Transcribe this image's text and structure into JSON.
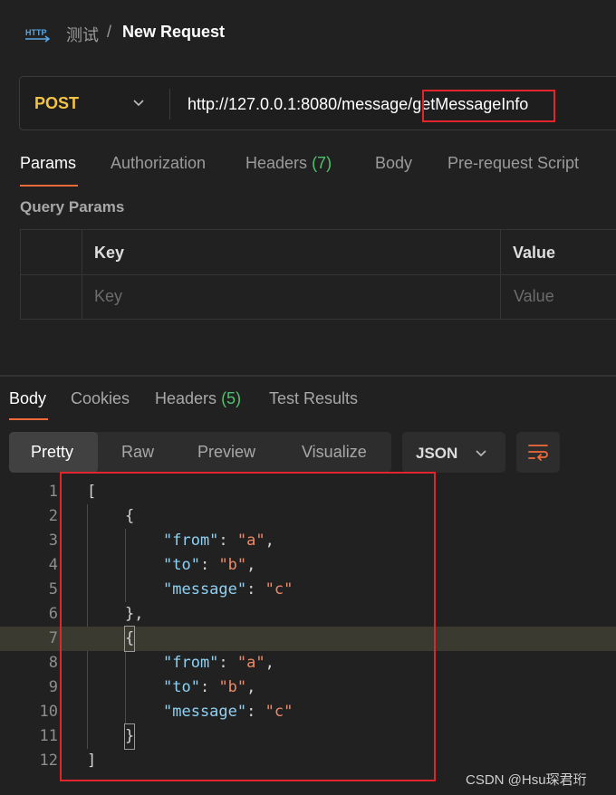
{
  "header": {
    "icon": "http-icon",
    "breadcrumb_parent": "测试",
    "breadcrumb_separator": "/",
    "title": "New Request"
  },
  "request": {
    "method": "POST",
    "url_base": "http://127.0.0.1:8080/message/",
    "url_endpoint": "getMessageInfo"
  },
  "request_tabs": [
    {
      "label": "Params",
      "active": true
    },
    {
      "label": "Authorization"
    },
    {
      "label": "Headers",
      "count": "(7)"
    },
    {
      "label": "Body"
    },
    {
      "label": "Pre-request Script"
    }
  ],
  "query_params": {
    "section_title": "Query Params",
    "columns": [
      "Key",
      "Value"
    ],
    "placeholders": [
      "Key",
      "Value"
    ]
  },
  "response_tabs": [
    {
      "label": "Body",
      "active": true
    },
    {
      "label": "Cookies"
    },
    {
      "label": "Headers",
      "count": "(5)"
    },
    {
      "label": "Test Results"
    }
  ],
  "view_modes": [
    "Pretty",
    "Raw",
    "Preview",
    "Visualize"
  ],
  "active_view": "Pretty",
  "format": "JSON",
  "line_numbers": [
    "1",
    "2",
    "3",
    "4",
    "5",
    "6",
    "7",
    "8",
    "9",
    "10",
    "11",
    "12"
  ],
  "response_body": {
    "open_bracket": "[",
    "close_bracket": "]",
    "open_brace": "{",
    "close_brace_comma": "},",
    "close_brace": "}",
    "items": [
      {
        "from_key": "\"from\"",
        "from_val": "\"a\"",
        "to_key": "\"to\"",
        "to_val": "\"b\"",
        "message_key": "\"message\"",
        "message_val": "\"c\""
      },
      {
        "from_key": "\"from\"",
        "from_val": "\"a\"",
        "to_key": "\"to\"",
        "to_val": "\"b\"",
        "message_key": "\"message\"",
        "message_val": "\"c\""
      }
    ],
    "highlighted_line": "7"
  },
  "watermark": "CSDN @Hsu琛君珩",
  "colors": {
    "accent": "#ef6c3a",
    "method": "#f3c344",
    "count": "#4fc36b",
    "highlight_box": "#e0262c",
    "json_key": "#8fd1f3",
    "json_string": "#ef8a6a"
  }
}
